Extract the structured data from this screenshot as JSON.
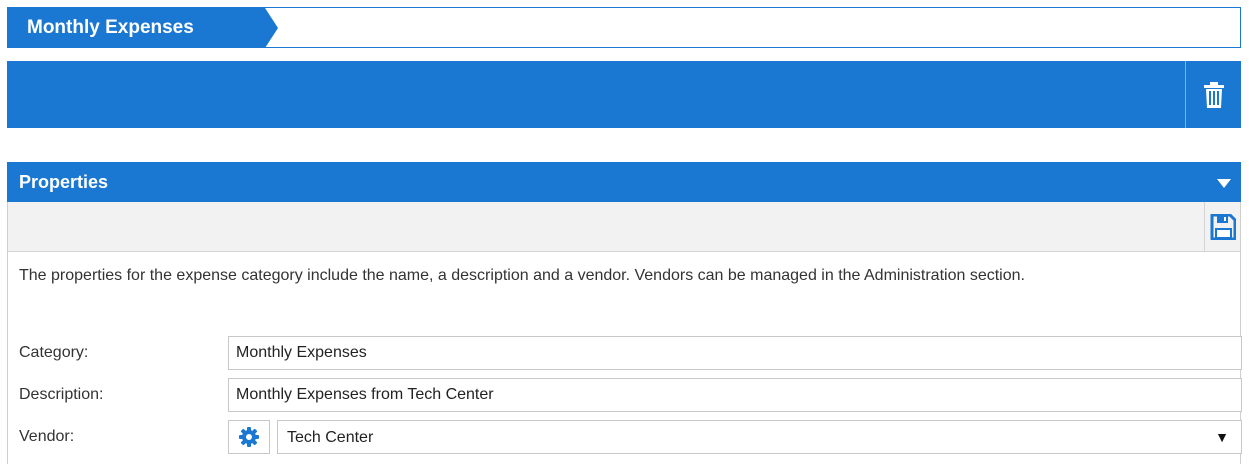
{
  "breadcrumb": {
    "label": "Monthly Expenses"
  },
  "toolbar": {
    "delete_icon": "trash-icon"
  },
  "properties": {
    "title": "Properties",
    "collapse_icon": "caret-down-icon",
    "save_icon": "floppy-disk-icon",
    "description": "The properties for the expense category include the name, a description and a vendor. Vendors can be managed in the Administration section.",
    "fields": {
      "category": {
        "label": "Category:",
        "value": "Monthly Expenses"
      },
      "description": {
        "label": "Description:",
        "value": "Monthly Expenses from Tech Center"
      },
      "vendor": {
        "label": "Vendor:",
        "value": "Tech Center",
        "settings_icon": "gear-icon"
      }
    }
  },
  "colors": {
    "accent": "#1a77d2",
    "toolbar_bg": "#f2f2f2"
  }
}
